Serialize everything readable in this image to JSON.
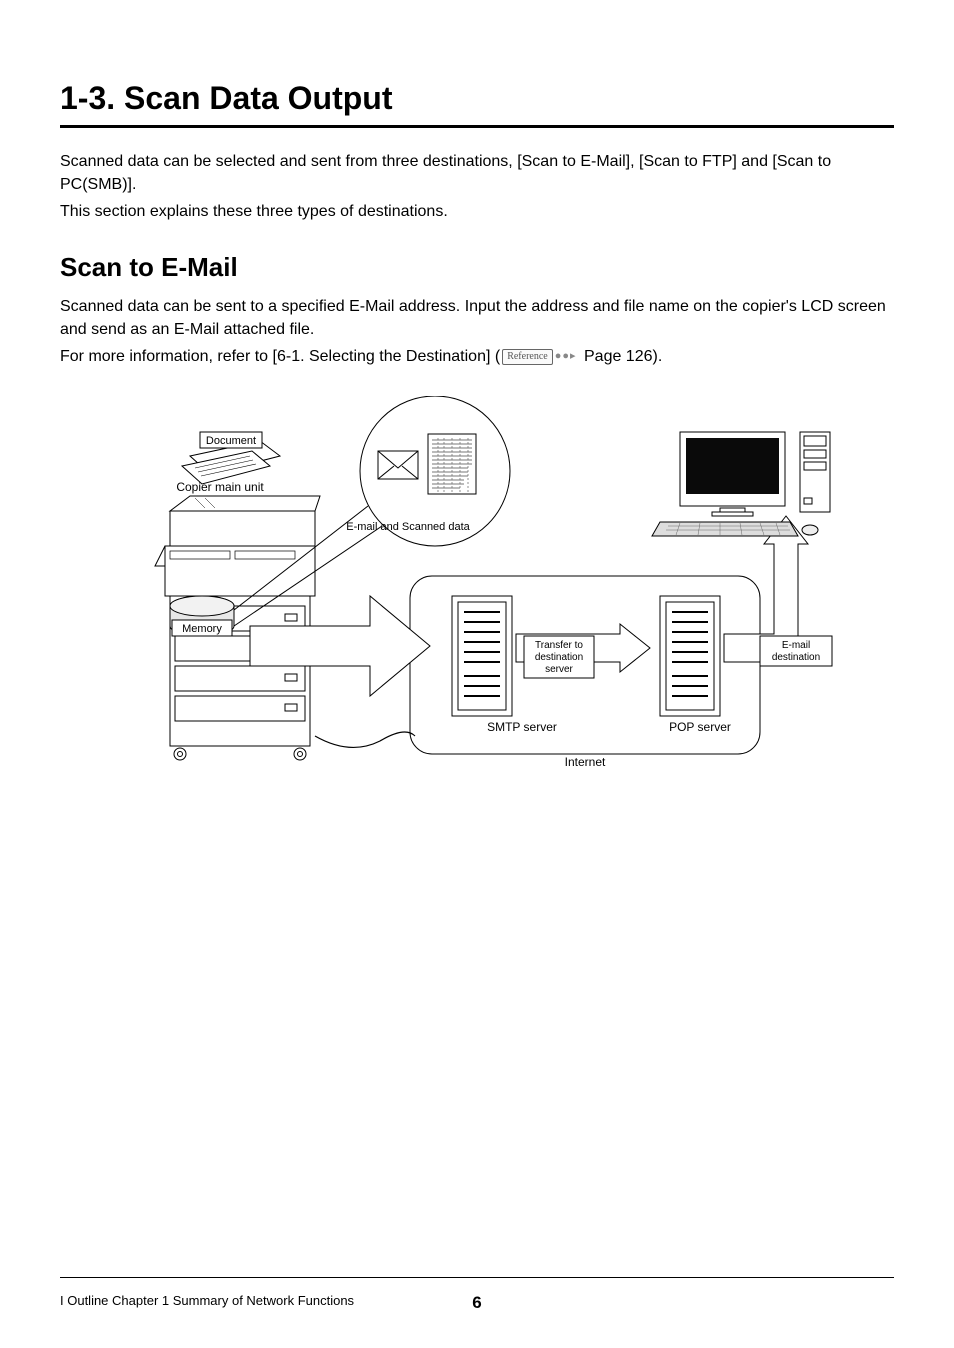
{
  "heading": "1-3. Scan Data Output",
  "intro": {
    "p1": "Scanned data can be selected and sent from three destinations, [Scan to E-Mail], [Scan to FTP] and [Scan to PC(SMB)].",
    "p2": "This section explains these three types of destinations."
  },
  "section": {
    "title": "Scan to E-Mail",
    "p1": "Scanned data can be sent to a specified E-Mail address. Input the address and file name on the copier's LCD screen and send as an E-Mail attached file.",
    "p2_pre": "For more information, refer to [6-1. Selecting the Destination] (",
    "ref_label": "Reference",
    "p2_post": " Page 126)."
  },
  "diagram": {
    "document_label": "Document",
    "copier_label": "Copier main unit",
    "memory_label": "Memory",
    "callout_label": "E-mail and Scanned data",
    "smtp_label": "SMTP server",
    "pop_label": "POP server",
    "transfer_label_l1": "Transfer to",
    "transfer_label_l2": "destination",
    "transfer_label_l3": "server",
    "dest_label_l1": "E-mail",
    "dest_label_l2": "destination",
    "internet_label": "Internet"
  },
  "footer": {
    "breadcrumb": "I Outline Chapter 1 Summary of Network Functions",
    "page_number": "6"
  }
}
